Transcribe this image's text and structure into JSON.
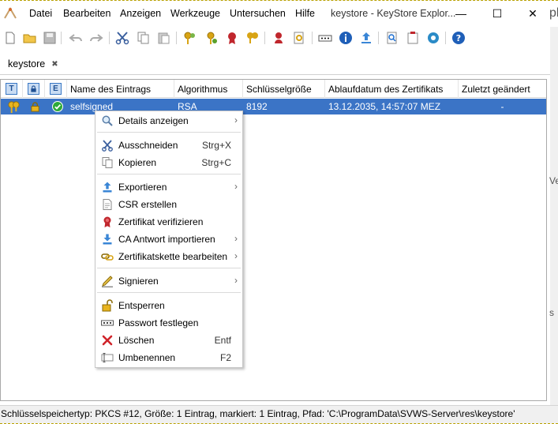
{
  "window": {
    "title": "keystore - KeyStore Explor...",
    "minimize": "—",
    "maximize": "☐",
    "close": "✕"
  },
  "menubar": [
    "Datei",
    "Bearbeiten",
    "Anzeigen",
    "Werkzeuge",
    "Untersuchen",
    "Hilfe"
  ],
  "tab": {
    "label": "keystore",
    "close": "✖"
  },
  "table": {
    "icon_headers": [
      "T",
      "🔒",
      "E"
    ],
    "headers": [
      "Name des Eintrags",
      "Algorithmus",
      "Schlüsselgröße",
      "Ablaufdatum des Zertifikats",
      "Zuletzt geändert"
    ],
    "rows": [
      {
        "name": "selfsigned",
        "algorithm": "RSA",
        "keysize": "8192",
        "expiry": "13.12.2035, 14:57:07 MEZ",
        "modified": "-"
      }
    ]
  },
  "context_menu": {
    "items": [
      {
        "label": "Details anzeigen",
        "accel": "",
        "submenu": true,
        "icon": "search-icon"
      },
      {
        "label": "Ausschneiden",
        "accel": "Strg+X",
        "submenu": false,
        "icon": "scissors-icon"
      },
      {
        "label": "Kopieren",
        "accel": "Strg+C",
        "submenu": false,
        "icon": "copy-icon"
      },
      {
        "label": "Exportieren",
        "accel": "",
        "submenu": true,
        "icon": "export-icon"
      },
      {
        "label": "CSR erstellen",
        "accel": "",
        "submenu": false,
        "icon": "document-icon"
      },
      {
        "label": "Zertifikat verifizieren",
        "accel": "",
        "submenu": false,
        "icon": "certificate-icon"
      },
      {
        "label": "CA Antwort importieren",
        "accel": "",
        "submenu": true,
        "icon": "import-icon"
      },
      {
        "label": "Zertifikatskette bearbeiten",
        "accel": "",
        "submenu": true,
        "icon": "chain-icon"
      },
      {
        "label": "Signieren",
        "accel": "",
        "submenu": true,
        "icon": "pen-icon"
      },
      {
        "label": "Entsperren",
        "accel": "",
        "submenu": false,
        "icon": "unlock-icon"
      },
      {
        "label": "Passwort festlegen",
        "accel": "",
        "submenu": false,
        "icon": "password-icon"
      },
      {
        "label": "Löschen",
        "accel": "Entf",
        "submenu": false,
        "icon": "delete-icon"
      },
      {
        "label": "Umbenennen",
        "accel": "F2",
        "submenu": false,
        "icon": "rename-icon"
      }
    ],
    "submenu_arrow": "›"
  },
  "right_panel": {
    "frag1": "pl",
    "frag2": "Ve",
    "frag3": "s"
  },
  "statusbar": {
    "text": "Schlüsselspeichertyp: PKCS #12, Größe: 1 Eintrag, markiert: 1 Eintrag, Pfad: 'C:\\ProgramData\\SVWS-Server\\res\\keystore'"
  },
  "colors": {
    "selection": "#3b74c6",
    "accent_blue": "#1e6fd0",
    "cert_red": "#c0272d",
    "key_gold": "#d8a415"
  }
}
